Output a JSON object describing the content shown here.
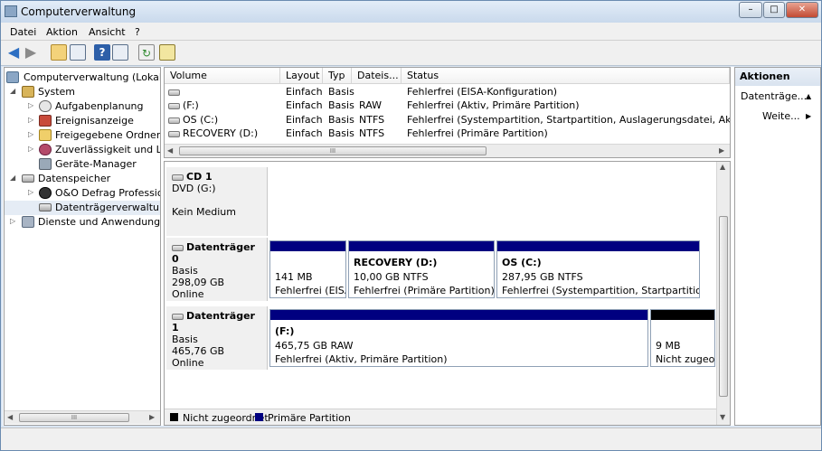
{
  "window": {
    "title": "Computerverwaltung",
    "controls": [
      "–",
      "□",
      "✕"
    ]
  },
  "menu": [
    "Datei",
    "Aktion",
    "Ansicht",
    "?"
  ],
  "tree": {
    "items": [
      {
        "label": "Computerverwaltung (Lokal)"
      },
      {
        "label": "System"
      },
      {
        "label": "Aufgabenplanung"
      },
      {
        "label": "Ereignisanzeige"
      },
      {
        "label": "Freigegebene Ordner"
      },
      {
        "label": "Zuverlässigkeit und Leis"
      },
      {
        "label": "Geräte-Manager"
      },
      {
        "label": "Datenspeicher"
      },
      {
        "label": "O&O Defrag Profession"
      },
      {
        "label": "Datenträgerverwaltung"
      },
      {
        "label": "Dienste und Anwendungen"
      }
    ],
    "scroll_glyph": "III"
  },
  "volumes": {
    "columns": [
      "Volume",
      "Layout",
      "Typ",
      "Dateis...",
      "Status"
    ],
    "rows": [
      {
        "volume": "",
        "layout": "Einfach",
        "typ": "Basis",
        "dateisystem": "",
        "status": "Fehlerfrei (EISA-Konfiguration)"
      },
      {
        "volume": "(F:)",
        "layout": "Einfach",
        "typ": "Basis",
        "dateisystem": "RAW",
        "status": "Fehlerfrei (Aktiv, Primäre Partition)"
      },
      {
        "volume": "OS (C:)",
        "layout": "Einfach",
        "typ": "Basis",
        "dateisystem": "NTFS",
        "status": "Fehlerfrei (Systempartition, Startpartition, Auslagerungsdatei, Aktiv, Abstur"
      },
      {
        "volume": "RECOVERY (D:)",
        "layout": "Einfach",
        "typ": "Basis",
        "dateisystem": "NTFS",
        "status": "Fehlerfrei (Primäre Partition)"
      }
    ],
    "scroll_glyph": "III"
  },
  "disks": [
    {
      "name": "CD 1",
      "line1": "DVD (G:)",
      "line2": "",
      "line3": "Kein Medium"
    },
    {
      "name": "Datenträger 0",
      "line1": "Basis",
      "line2": "298,09 GB",
      "line3": "Online",
      "partitions": [
        {
          "name": "",
          "size": "141 MB",
          "status": "Fehlerfrei (EISA"
        },
        {
          "name": "RECOVERY  (D:)",
          "size": "10,00 GB NTFS",
          "status": "Fehlerfrei (Primäre Partition)"
        },
        {
          "name": "OS  (C:)",
          "size": "287,95 GB NTFS",
          "status": "Fehlerfrei (Systempartition, Startpartition, Au"
        }
      ]
    },
    {
      "name": "Datenträger 1",
      "line1": "Basis",
      "line2": "465,76 GB",
      "line3": "Online",
      "partitions": [
        {
          "name": "(F:)",
          "size": "465,75 GB RAW",
          "status": "Fehlerfrei (Aktiv, Primäre Partition)"
        },
        {
          "name": "",
          "size": "9 MB",
          "status": "Nicht zugeor"
        }
      ]
    }
  ],
  "legend": [
    {
      "label": "Nicht zugeordnet",
      "color": "#000000"
    },
    {
      "label": "Primäre Partition",
      "color": "#000080"
    }
  ],
  "actions": {
    "header": "Aktionen",
    "items": [
      {
        "label": "Datenträge...",
        "arrow": "▲"
      },
      {
        "label": "Weite...",
        "arrow": "▶"
      }
    ]
  }
}
